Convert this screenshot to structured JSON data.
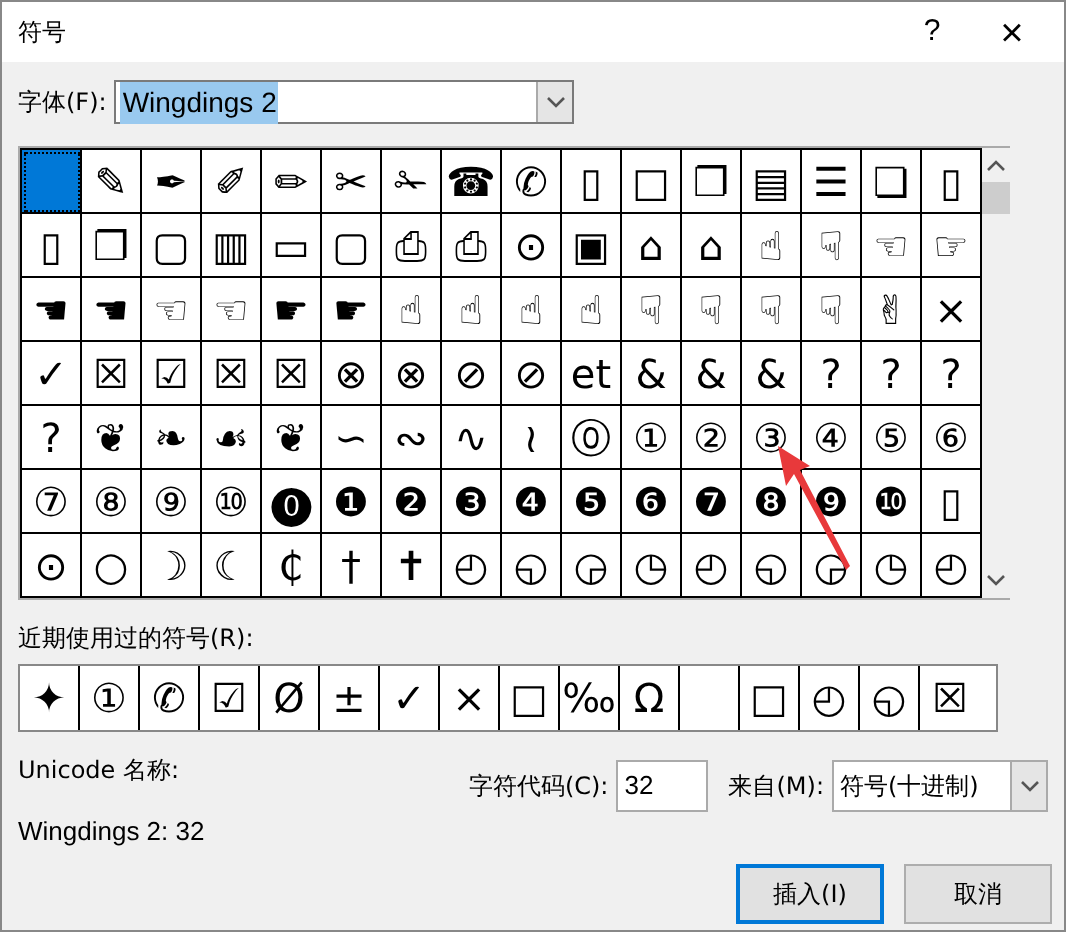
{
  "window": {
    "title": "符号",
    "help": "?",
    "close": "×"
  },
  "font": {
    "label": "字体(F):",
    "value": "Wingdings 2"
  },
  "grid": {
    "rows": [
      [
        {
          "selected": true
        },
        {
          "glyph": "✎",
          "selected": false
        },
        {
          "glyph": "✒",
          "selected": false
        },
        {
          "glyph": "✐",
          "selected": false
        },
        {
          "glyph": "✏",
          "selected": false
        },
        {
          "glyph": "✂",
          "selected": false
        },
        {
          "glyph": "✁",
          "selected": false
        },
        {
          "glyph": "☎",
          "selected": false
        },
        {
          "glyph": "✆",
          "selected": false
        },
        {
          "glyph": "▯",
          "selected": false
        },
        {
          "glyph": "□",
          "selected": false
        },
        {
          "glyph": "❐",
          "selected": false
        },
        {
          "glyph": "▤",
          "selected": false
        },
        {
          "glyph": "☰",
          "selected": false
        },
        {
          "glyph": "❏",
          "selected": false
        },
        {
          "glyph": "▯",
          "selected": false
        }
      ],
      [
        {
          "glyph": "▯",
          "selected": false
        },
        {
          "glyph": "❐",
          "selected": false
        },
        {
          "glyph": "▢",
          "selected": false
        },
        {
          "glyph": "▥",
          "selected": false
        },
        {
          "glyph": "▭",
          "selected": false
        },
        {
          "glyph": "▢",
          "selected": false
        },
        {
          "glyph": "⎙",
          "selected": false
        },
        {
          "glyph": "⎙",
          "selected": false
        },
        {
          "glyph": "⊙",
          "selected": false
        },
        {
          "glyph": "▣",
          "selected": false
        },
        {
          "glyph": "⌂",
          "selected": false
        },
        {
          "glyph": "⌂",
          "selected": false
        },
        {
          "glyph": "☝",
          "selected": false
        },
        {
          "glyph": "☟",
          "selected": false
        },
        {
          "glyph": "☜",
          "selected": false
        },
        {
          "glyph": "☞",
          "selected": false
        }
      ],
      [
        {
          "glyph": "☚",
          "selected": false
        },
        {
          "glyph": "☚",
          "selected": false
        },
        {
          "glyph": "☜",
          "selected": false
        },
        {
          "glyph": "☜",
          "selected": false
        },
        {
          "glyph": "☛",
          "selected": false
        },
        {
          "glyph": "☛",
          "selected": false
        },
        {
          "glyph": "☝",
          "selected": false
        },
        {
          "glyph": "☝",
          "selected": false
        },
        {
          "glyph": "☝",
          "selected": false
        },
        {
          "glyph": "☝",
          "selected": false
        },
        {
          "glyph": "☟",
          "selected": false
        },
        {
          "glyph": "☟",
          "selected": false
        },
        {
          "glyph": "☟",
          "selected": false
        },
        {
          "glyph": "☟",
          "selected": false
        },
        {
          "glyph": "✌",
          "selected": false
        },
        {
          "glyph": "×",
          "selected": false
        }
      ],
      [
        {
          "glyph": "✓",
          "selected": false
        },
        {
          "glyph": "☒",
          "selected": false
        },
        {
          "glyph": "☑",
          "selected": false
        },
        {
          "glyph": "☒",
          "selected": false
        },
        {
          "glyph": "☒",
          "selected": false
        },
        {
          "glyph": "⊗",
          "selected": false
        },
        {
          "glyph": "⊗",
          "selected": false
        },
        {
          "glyph": "⊘",
          "selected": false
        },
        {
          "glyph": "⊘",
          "selected": false
        },
        {
          "glyph": "et",
          "selected": false
        },
        {
          "glyph": "&",
          "selected": false
        },
        {
          "glyph": "&",
          "selected": false
        },
        {
          "glyph": "&",
          "selected": false
        },
        {
          "glyph": "?",
          "selected": false
        },
        {
          "glyph": "?",
          "selected": false
        },
        {
          "glyph": "?",
          "selected": false
        }
      ],
      [
        {
          "glyph": "?",
          "selected": false
        },
        {
          "glyph": "❦",
          "selected": false
        },
        {
          "glyph": "❧",
          "selected": false
        },
        {
          "glyph": "☙",
          "selected": false
        },
        {
          "glyph": "❦",
          "selected": false
        },
        {
          "glyph": "∽",
          "selected": false
        },
        {
          "glyph": "∾",
          "selected": false
        },
        {
          "glyph": "∿",
          "selected": false
        },
        {
          "glyph": "≀",
          "selected": false
        },
        {
          "glyph": "⓪",
          "selected": false
        },
        {
          "glyph": "①",
          "selected": false
        },
        {
          "glyph": "②",
          "selected": false
        },
        {
          "glyph": "③",
          "selected": false
        },
        {
          "glyph": "④",
          "selected": false
        },
        {
          "glyph": "⑤",
          "selected": false
        },
        {
          "glyph": "⑥",
          "selected": false
        }
      ],
      [
        {
          "glyph": "⑦",
          "selected": false
        },
        {
          "glyph": "⑧",
          "selected": false
        },
        {
          "glyph": "⑨",
          "selected": false
        },
        {
          "glyph": "⑩",
          "selected": false
        },
        {
          "glyph": "⓿",
          "selected": false
        },
        {
          "glyph": "❶",
          "selected": false
        },
        {
          "glyph": "❷",
          "selected": false
        },
        {
          "glyph": "❸",
          "selected": false
        },
        {
          "glyph": "❹",
          "selected": false
        },
        {
          "glyph": "❺",
          "selected": false
        },
        {
          "glyph": "❻",
          "selected": false
        },
        {
          "glyph": "❼",
          "selected": false
        },
        {
          "glyph": "❽",
          "selected": false
        },
        {
          "glyph": "❾",
          "selected": false
        },
        {
          "glyph": "❿",
          "selected": false
        },
        {
          "glyph": "▯",
          "selected": false
        }
      ],
      [
        {
          "glyph": "⊙",
          "selected": false
        },
        {
          "glyph": "○",
          "selected": false
        },
        {
          "glyph": "☽",
          "selected": false
        },
        {
          "glyph": "☾",
          "selected": false
        },
        {
          "glyph": "₵",
          "selected": false
        },
        {
          "glyph": "†",
          "selected": false
        },
        {
          "glyph": "✝",
          "selected": false
        },
        {
          "glyph": "◴",
          "selected": false
        },
        {
          "glyph": "◵",
          "selected": false
        },
        {
          "glyph": "◶",
          "selected": false
        },
        {
          "glyph": "◷",
          "selected": false
        },
        {
          "glyph": "◴",
          "selected": false
        },
        {
          "glyph": "◵",
          "selected": false
        },
        {
          "glyph": "◶",
          "selected": false
        },
        {
          "glyph": "◷",
          "selected": false
        },
        {
          "glyph": "◴",
          "selected": false
        }
      ]
    ]
  },
  "recent": {
    "label": "近期使用过的符号(R):",
    "items": [
      {
        "glyph": "✦"
      },
      {
        "glyph": "①"
      },
      {
        "glyph": "✆"
      },
      {
        "glyph": "☑"
      },
      {
        "glyph": "Ø"
      },
      {
        "glyph": "±"
      },
      {
        "glyph": "✓"
      },
      {
        "glyph": "×"
      },
      {
        "glyph": "□"
      },
      {
        "glyph": "‰"
      },
      {
        "glyph": "Ω"
      },
      {
        "kind": "empty"
      },
      {
        "glyph": "□"
      },
      {
        "glyph": "◴"
      },
      {
        "glyph": "◵"
      },
      {
        "glyph": "☒"
      }
    ]
  },
  "unicode_name": {
    "label": "Unicode 名称:",
    "value": "Wingdings 2: 32"
  },
  "char_code": {
    "label": "字符代码(C):",
    "value": "32"
  },
  "from": {
    "label": "来自(M):",
    "value": "符号(十进制)"
  },
  "buttons": [
    {
      "label": "插入(I)",
      "default": true
    },
    {
      "label": "取消",
      "default": false
    }
  ]
}
